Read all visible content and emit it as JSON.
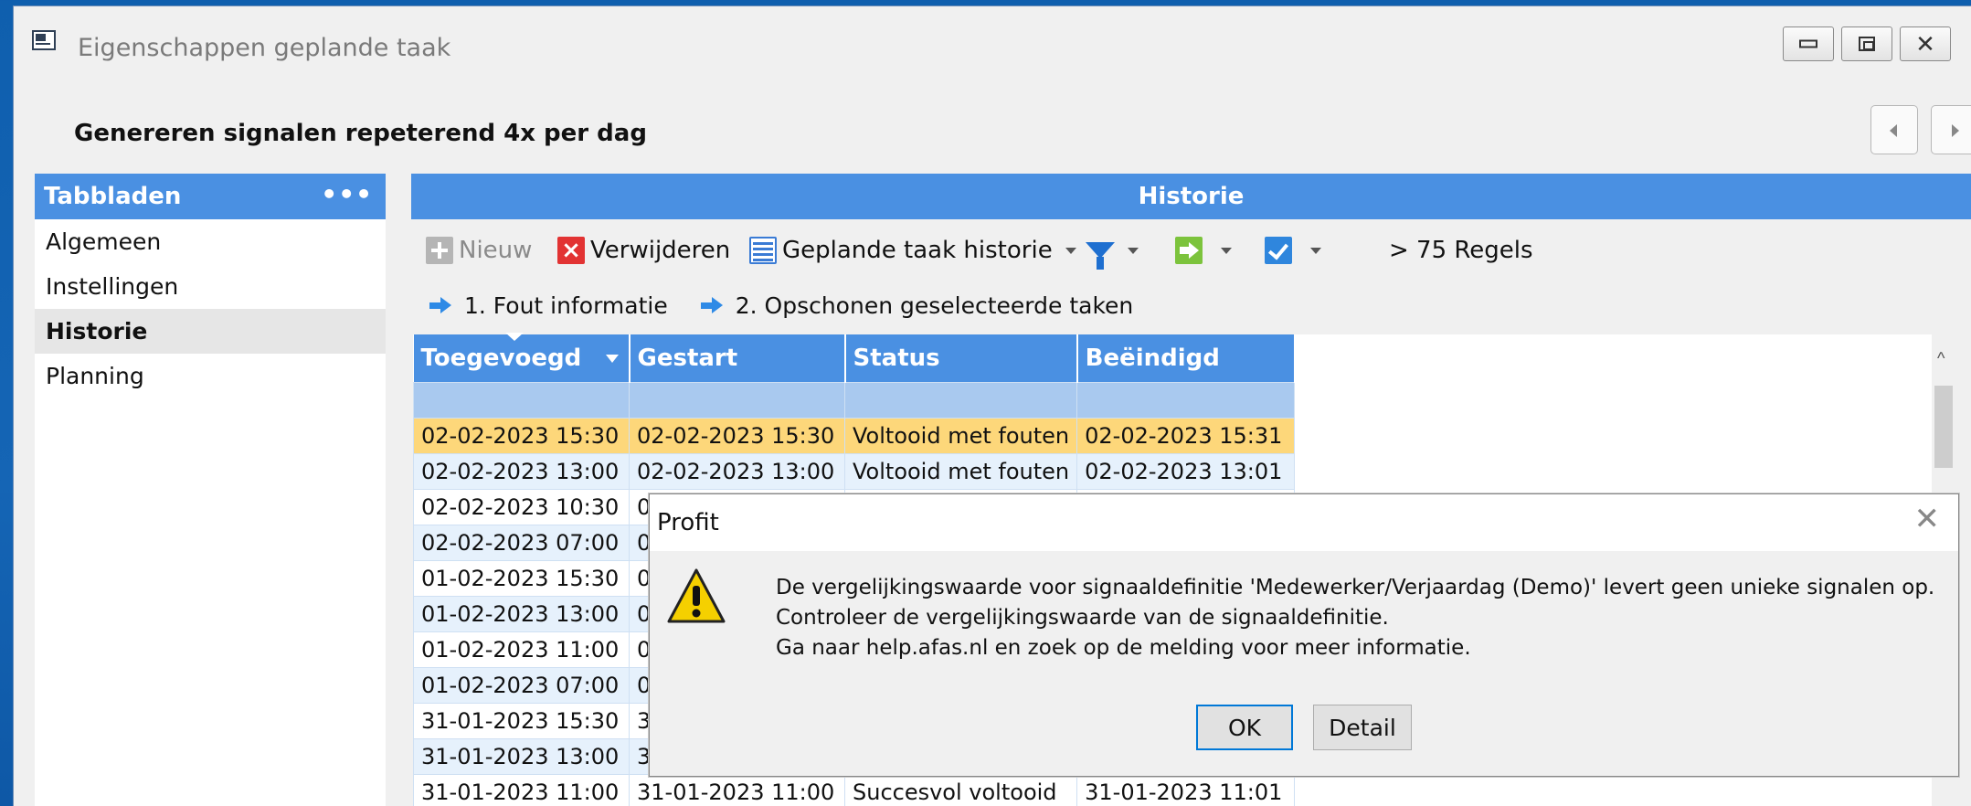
{
  "window": {
    "title": "Eigenschappen geplande taak",
    "controls": {
      "minimize": "",
      "maximize": "",
      "close": "✕"
    }
  },
  "page": {
    "title": "Genereren signalen repeterend 4x per dag"
  },
  "sidebar": {
    "header": "Tabbladen",
    "more": "•••",
    "items": [
      {
        "label": "Algemeen",
        "active": false
      },
      {
        "label": "Instellingen",
        "active": false
      },
      {
        "label": "Historie",
        "active": true
      },
      {
        "label": "Planning",
        "active": false
      }
    ]
  },
  "main": {
    "header": "Historie",
    "toolbar": {
      "new": "Nieuw",
      "delete": "Verwijderen",
      "history": "Geplande taak historie",
      "count": "> 75 Regels"
    },
    "actions": [
      "1. Fout informatie",
      "2. Opschonen geselecteerde taken"
    ],
    "grid": {
      "columns": [
        "Toegevoegd",
        "Gestart",
        "Status",
        "Beëindigd"
      ],
      "rows": [
        [
          "02-02-2023 15:30",
          "02-02-2023 15:30",
          "Voltooid met fouten",
          "02-02-2023 15:31"
        ],
        [
          "02-02-2023 13:00",
          "02-02-2023 13:00",
          "Voltooid met fouten",
          "02-02-2023 13:01"
        ],
        [
          "02-02-2023 10:30",
          "0",
          "",
          ""
        ],
        [
          "02-02-2023 07:00",
          "0",
          "",
          ""
        ],
        [
          "01-02-2023 15:30",
          "0",
          "",
          ""
        ],
        [
          "01-02-2023 13:00",
          "0",
          "",
          ""
        ],
        [
          "01-02-2023 11:00",
          "0",
          "",
          ""
        ],
        [
          "01-02-2023 07:00",
          "0",
          "",
          ""
        ],
        [
          "31-01-2023 15:30",
          "3",
          "",
          ""
        ],
        [
          "31-01-2023 13:00",
          "3",
          "",
          ""
        ],
        [
          "31-01-2023 11:00",
          "31-01-2023 11:00",
          "Succesvol voltooid",
          "31-01-2023 11:01"
        ]
      ]
    }
  },
  "dialog": {
    "title": "Profit",
    "close": "✕",
    "message": [
      "De vergelijkingswaarde voor signaaldefinitie 'Medewerker/Verjaardag (Demo)' levert geen unieke signalen op.",
      "Controleer de vergelijkingswaarde van de signaaldefinitie.",
      "Ga naar help.afas.nl en zoek op de melding voor meer informatie."
    ],
    "ok": "OK",
    "detail": "Detail"
  },
  "colors": {
    "accent": "#4a90e2",
    "selected_row": "#fdd77a",
    "alt_row": "#e6f1fc",
    "warning": "#f5d000"
  }
}
